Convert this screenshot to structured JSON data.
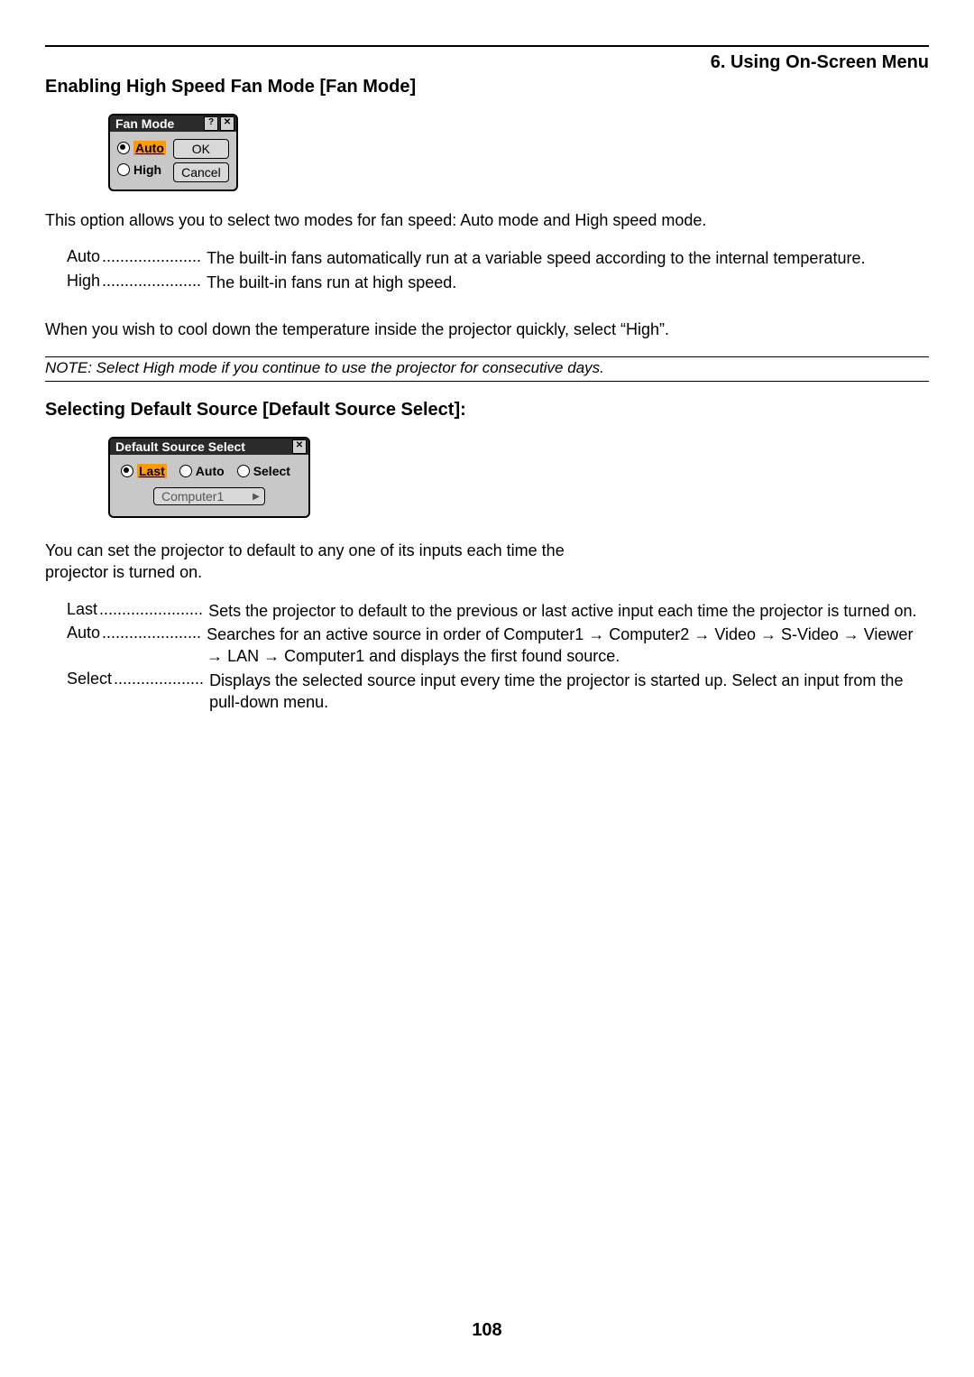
{
  "chapter_header": "6. Using On-Screen Menu",
  "section1": {
    "heading": "Enabling High Speed Fan Mode [Fan Mode]",
    "intro": "This option allows you to select two modes for fan speed: Auto mode and High speed mode.",
    "defs": [
      {
        "term": "Auto",
        "dots": "......................",
        "desc": "The built-in fans automatically run at a variable speed according to the internal temperature."
      },
      {
        "term": "High",
        "dots": "......................",
        "desc": "The built-in fans run at high speed."
      }
    ],
    "followup": "When you wish to cool down the temperature inside the projector quickly, select “High”.",
    "note": "NOTE: Select High mode if you continue to use the projector for consecutive days."
  },
  "fan_dialog": {
    "title": "Fan Mode",
    "help_icon": "?",
    "close_icon": "✕",
    "option_auto": "Auto",
    "option_high": "High",
    "ok": "OK",
    "cancel": "Cancel"
  },
  "section2": {
    "heading": "Selecting Default Source [Default Source Select]:",
    "intro": "You can set the projector to default to any one of its inputs each time the projector is turned on.",
    "defs": [
      {
        "term": "Last",
        "dots": ".......................",
        "desc": "Sets the projector to default to the previous or last active input each time the projector is turned on."
      },
      {
        "term": "Auto",
        "dots": "......................",
        "desc": "Searches for an active source in order of Computer1 → Computer2 → Video → S-Video → Viewer → LAN → Computer1 and displays the first found source."
      },
      {
        "term": "Select",
        "dots": "....................",
        "desc": "Displays the selected source input every time the projector is started up. Select an input from the pull-down menu."
      }
    ]
  },
  "src_dialog": {
    "title": "Default Source Select",
    "close_icon": "✕",
    "option_last": "Last",
    "option_auto": "Auto",
    "option_select": "Select",
    "dropdown_value": "Computer1",
    "dropdown_arrow": "▶"
  },
  "page_number": "108"
}
